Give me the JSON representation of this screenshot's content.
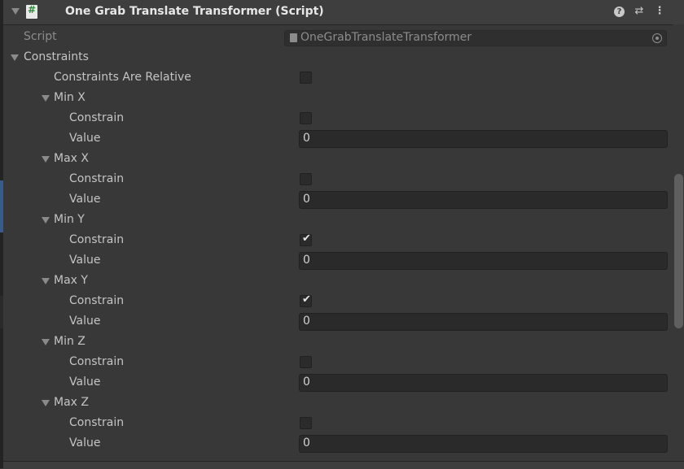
{
  "header": {
    "title": "One Grab Translate Transformer (Script)",
    "help_glyph": "?",
    "preset_glyph": "⇄",
    "menu_glyph": "⋮"
  },
  "script_field": {
    "label": "Script",
    "value": "OneGrabTranslateTransformer"
  },
  "constraints": {
    "label": "Constraints",
    "relative_label": "Constraints Are Relative",
    "relative_checked": false,
    "groups": [
      {
        "label": "Min X",
        "constrain_label": "Constrain",
        "constrain": false,
        "value_label": "Value",
        "value": "0"
      },
      {
        "label": "Max X",
        "constrain_label": "Constrain",
        "constrain": false,
        "value_label": "Value",
        "value": "0"
      },
      {
        "label": "Min Y",
        "constrain_label": "Constrain",
        "constrain": true,
        "value_label": "Value",
        "value": "0"
      },
      {
        "label": "Max Y",
        "constrain_label": "Constrain",
        "constrain": true,
        "value_label": "Value",
        "value": "0"
      },
      {
        "label": "Min Z",
        "constrain_label": "Constrain",
        "constrain": false,
        "value_label": "Value",
        "value": "0"
      },
      {
        "label": "Max Z",
        "constrain_label": "Constrain",
        "constrain": false,
        "value_label": "Value",
        "value": "0"
      }
    ]
  },
  "icons": {
    "component": "script-hash-icon",
    "checkmark": "✔"
  }
}
